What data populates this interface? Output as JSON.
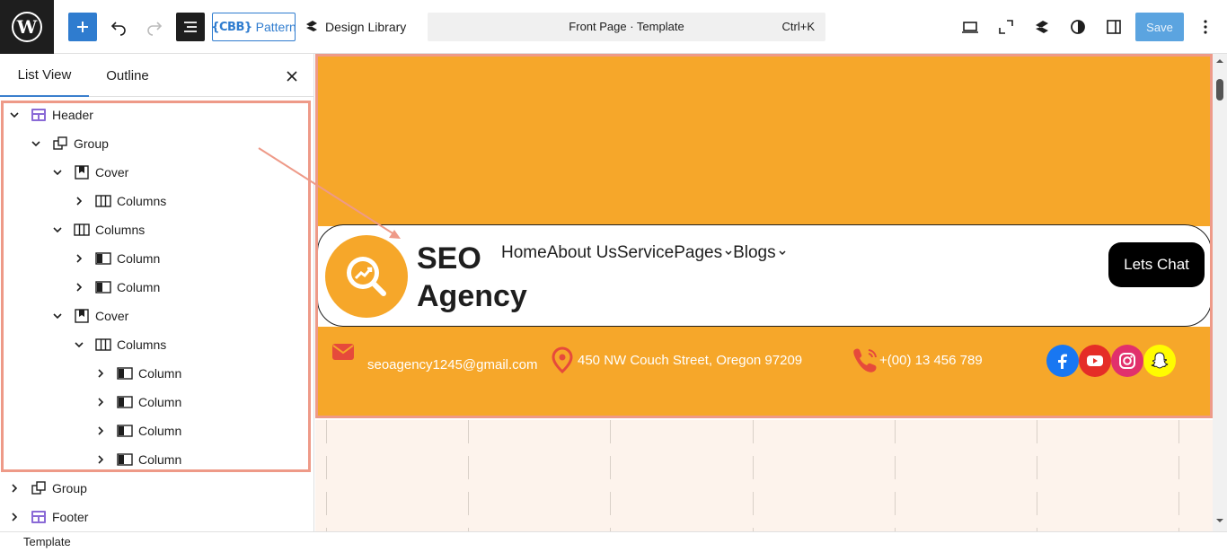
{
  "toolbar": {
    "pattern_brand": "{CBB}",
    "pattern_label": "Pattern",
    "design_library_label": "Design Library",
    "document_title": "Front Page · Template",
    "shortcut": "Ctrl+K",
    "save_label": "Save"
  },
  "sidebar": {
    "tab_list": "List View",
    "tab_outline": "Outline",
    "tree": [
      {
        "label": "Header",
        "level": 0,
        "expanded": true,
        "icon": "template-part-icon"
      },
      {
        "label": "Group",
        "level": 1,
        "expanded": true,
        "icon": "group-icon"
      },
      {
        "label": "Cover",
        "level": 2,
        "expanded": true,
        "icon": "cover-icon"
      },
      {
        "label": "Columns",
        "level": 3,
        "expanded": false,
        "icon": "columns-icon"
      },
      {
        "label": "Columns",
        "level": 2,
        "expanded": true,
        "icon": "columns-icon"
      },
      {
        "label": "Column",
        "level": 3,
        "expanded": false,
        "icon": "column-icon"
      },
      {
        "label": "Column",
        "level": 3,
        "expanded": false,
        "icon": "column-icon"
      },
      {
        "label": "Cover",
        "level": 2,
        "expanded": true,
        "icon": "cover-icon"
      },
      {
        "label": "Columns",
        "level": 3,
        "expanded": true,
        "icon": "columns-icon"
      },
      {
        "label": "Column",
        "level": 4,
        "expanded": false,
        "icon": "column-icon"
      },
      {
        "label": "Column",
        "level": 4,
        "expanded": false,
        "icon": "column-icon"
      },
      {
        "label": "Column",
        "level": 4,
        "expanded": false,
        "icon": "column-icon"
      },
      {
        "label": "Column",
        "level": 4,
        "expanded": false,
        "icon": "column-icon"
      },
      {
        "label": "Group",
        "level": 0,
        "expanded": false,
        "icon": "group-icon"
      },
      {
        "label": "Footer",
        "level": 0,
        "expanded": false,
        "icon": "template-part-icon"
      }
    ]
  },
  "canvas": {
    "logo_line1": "SEO",
    "logo_line2": "Agency",
    "nav": [
      {
        "label": "Home",
        "dropdown": false
      },
      {
        "label": "About Us",
        "dropdown": false
      },
      {
        "label": "Service",
        "dropdown": false
      },
      {
        "label": "Pages",
        "dropdown": true
      },
      {
        "label": "Blogs",
        "dropdown": true
      }
    ],
    "cta_label": "Lets Chat",
    "email": "seoagency1245@gmail.com",
    "address": "450 NW Couch Street, Oregon 97209",
    "phone": "+(00) 13 456 789",
    "social": [
      {
        "icon": "facebook-icon",
        "color": "#1877f2"
      },
      {
        "icon": "youtube-icon",
        "color": "#e52d27"
      },
      {
        "icon": "instagram-icon",
        "color": "#e1306c"
      },
      {
        "icon": "snapchat-icon",
        "color": "#fffc00"
      }
    ]
  },
  "colors": {
    "accent": "#2f7ccf",
    "brand_orange": "#f6a72a",
    "highlight": "#ee9a88"
  },
  "footer": {
    "breadcrumb": "Template"
  }
}
